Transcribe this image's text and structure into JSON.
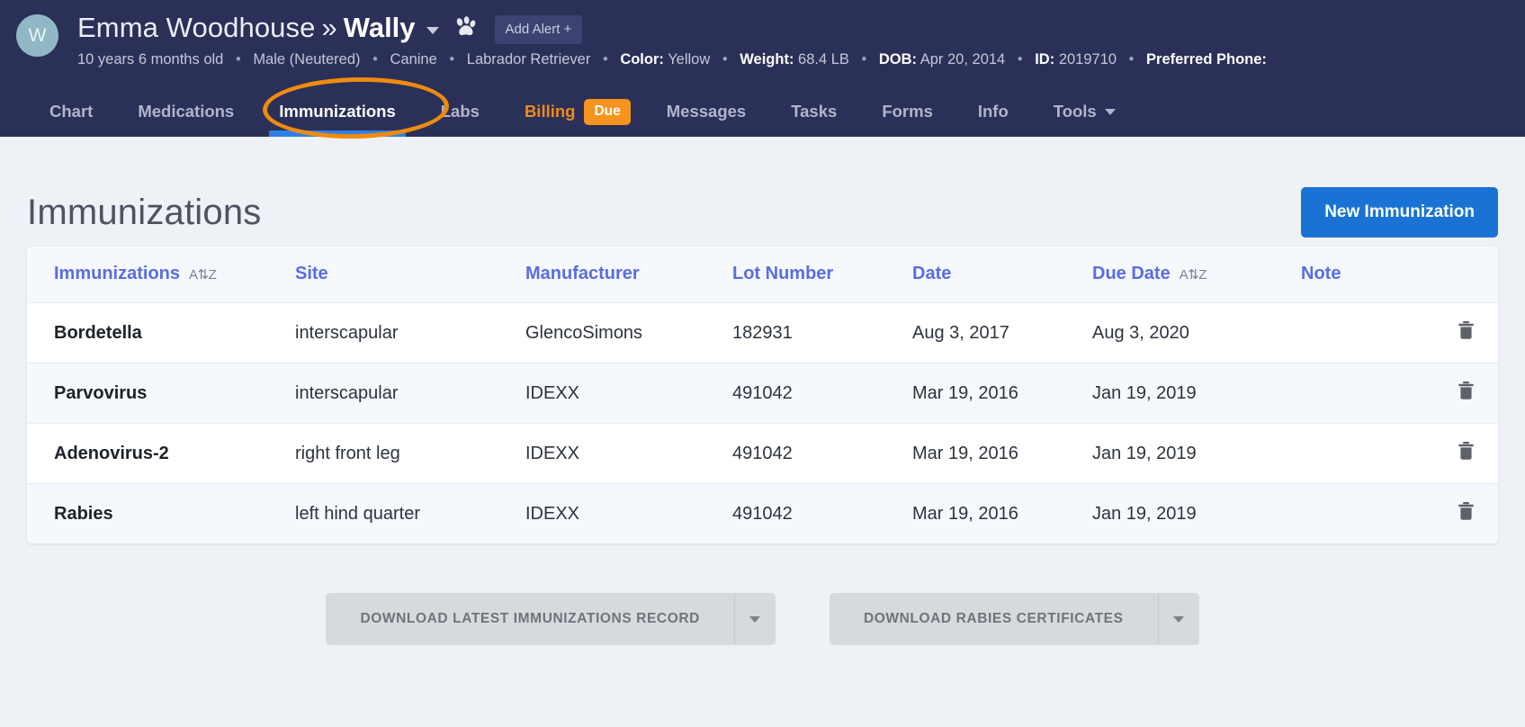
{
  "header": {
    "avatar_initial": "W",
    "owner_name": "Emma Woodhouse",
    "separator": "»",
    "pet_name": "Wally",
    "add_alert_label": "Add Alert +",
    "meta": [
      {
        "label": "",
        "value": "10 years 6 months old"
      },
      {
        "label": "",
        "value": "Male (Neutered)"
      },
      {
        "label": "",
        "value": "Canine"
      },
      {
        "label": "",
        "value": "Labrador Retriever"
      },
      {
        "label": "Color:",
        "value": "Yellow"
      },
      {
        "label": "Weight:",
        "value": "68.4 LB"
      },
      {
        "label": "DOB:",
        "value": "Apr 20, 2014"
      },
      {
        "label": "ID:",
        "value": "2019710"
      },
      {
        "label": "Preferred Phone:",
        "value": ""
      }
    ],
    "accent_navy": "#2b3058",
    "avatar_color": "#8fb8c4"
  },
  "nav": {
    "items": [
      {
        "label": "Chart",
        "active": false
      },
      {
        "label": "Medications",
        "active": false
      },
      {
        "label": "Immunizations",
        "active": true
      },
      {
        "label": "Labs",
        "active": false
      },
      {
        "label": "Billing",
        "active": false
      },
      {
        "label": "Messages",
        "active": false
      },
      {
        "label": "Tasks",
        "active": false
      },
      {
        "label": "Forms",
        "active": false
      },
      {
        "label": "Info",
        "active": false
      },
      {
        "label": "Tools",
        "active": false
      }
    ],
    "billing_badge": "Due",
    "active_underline_color": "#2f7fe8",
    "billing_color": "#f08a1a",
    "badge_color": "#f7941e",
    "annotation_color": "#ef8b0e"
  },
  "page": {
    "title": "Immunizations",
    "new_button_label": "New Immunization",
    "new_button_color": "#1a73d4"
  },
  "table": {
    "columns": [
      {
        "label": "Immunizations",
        "sort_icon": "A⇅Z"
      },
      {
        "label": "Site",
        "sort_icon": ""
      },
      {
        "label": "Manufacturer",
        "sort_icon": ""
      },
      {
        "label": "Lot Number",
        "sort_icon": ""
      },
      {
        "label": "Date",
        "sort_icon": ""
      },
      {
        "label": "Due Date",
        "sort_icon": "A⇅Z"
      },
      {
        "label": "Note",
        "sort_icon": ""
      }
    ],
    "header_color": "#5b6ce0",
    "rows": [
      {
        "immunization": "Bordetella",
        "site": "interscapular",
        "manufacturer": "GlencoSimons",
        "lot_number": "182931",
        "date": "Aug 3, 2017",
        "due_date": "Aug 3, 2020",
        "note": "",
        "delete_icon": "trash-icon"
      },
      {
        "immunization": "Parvovirus",
        "site": "interscapular",
        "manufacturer": "IDEXX",
        "lot_number": "491042",
        "date": "Mar 19, 2016",
        "due_date": "Jan 19, 2019",
        "note": "",
        "delete_icon": "trash-icon"
      },
      {
        "immunization": "Adenovirus-2",
        "site": "right front leg",
        "manufacturer": "IDEXX",
        "lot_number": "491042",
        "date": "Mar 19, 2016",
        "due_date": "Jan 19, 2019",
        "note": "",
        "delete_icon": "trash-icon"
      },
      {
        "immunization": "Rabies",
        "site": "left hind quarter",
        "manufacturer": "IDEXX",
        "lot_number": "491042",
        "date": "Mar 19, 2016",
        "due_date": "Jan 19, 2019",
        "note": "",
        "delete_icon": "trash-icon"
      }
    ]
  },
  "downloads": [
    {
      "label": "DOWNLOAD LATEST IMMUNIZATIONS RECORD"
    },
    {
      "label": "DOWNLOAD RABIES CERTIFICATES"
    }
  ]
}
